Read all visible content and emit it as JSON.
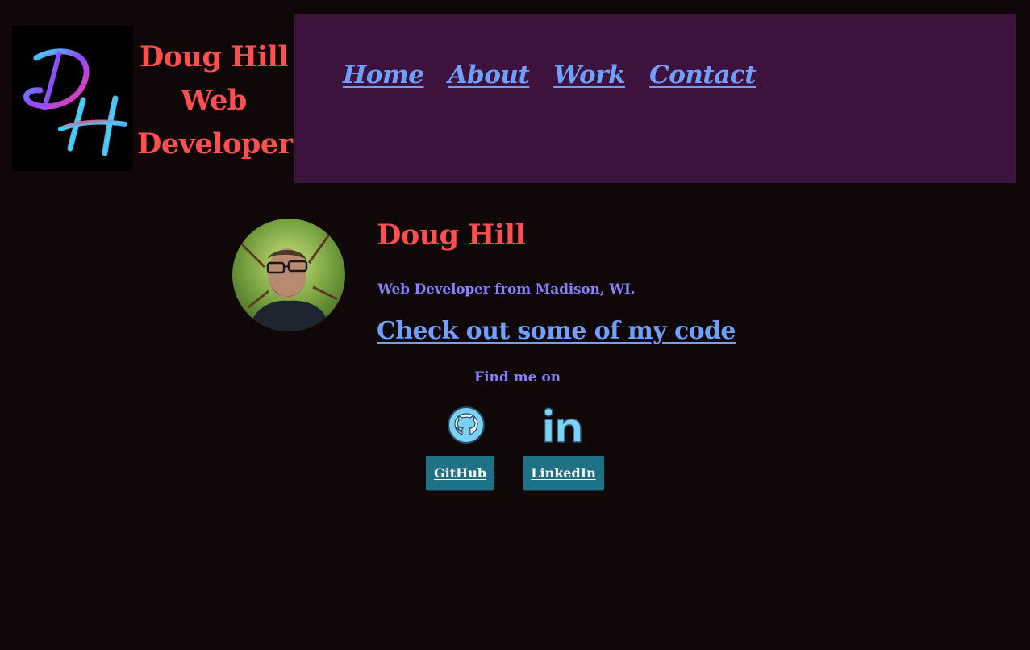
{
  "brand": {
    "logo_icon": "dh-monogram-icon",
    "line1": "Doug Hill",
    "line2": "Web",
    "line3": "Developer"
  },
  "nav": {
    "items": [
      {
        "label": "Home"
      },
      {
        "label": "About"
      },
      {
        "label": "Work"
      },
      {
        "label": "Contact"
      }
    ]
  },
  "profile": {
    "avatar_icon": "profile-photo",
    "name": "Doug Hill",
    "tagline": "Web Developer from Madison, WI.",
    "code_link": "Check out some of my code"
  },
  "social": {
    "heading": "Find me on",
    "github": {
      "icon": "github-icon",
      "label": "GitHub"
    },
    "linkedin": {
      "icon": "linkedin-icon",
      "label": "LinkedIn"
    }
  },
  "colors": {
    "background": "#100808",
    "nav_background": "#3d133d",
    "accent_red": "#ff4f4f",
    "link_blue": "#6fa0ff",
    "text_purple": "#8a80ff",
    "button_teal": "#1f7185"
  }
}
